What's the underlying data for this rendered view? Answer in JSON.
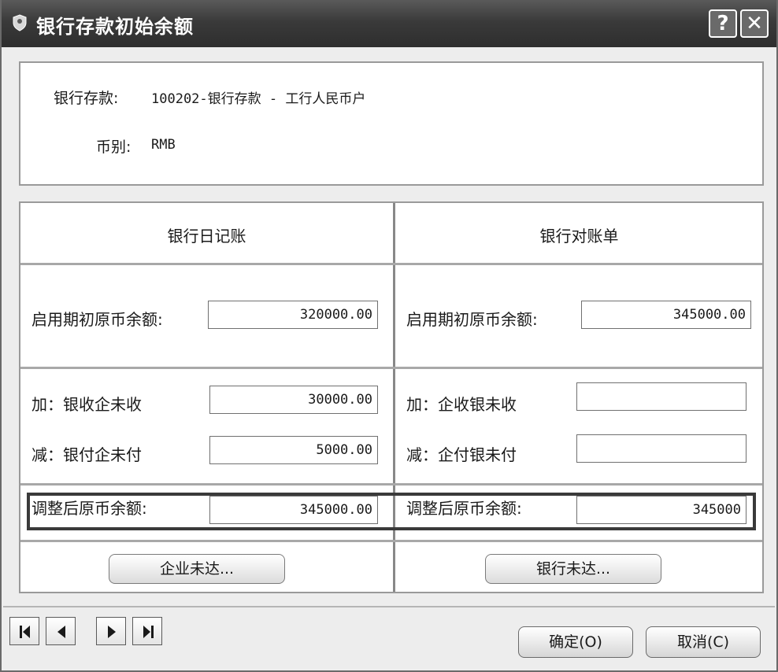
{
  "window": {
    "title": "银行存款初始余额",
    "help_label": "?",
    "close_label": "✕"
  },
  "account_info": {
    "bank_label": "银行存款:",
    "bank_value": "100202-银行存款 - 工行人民币户",
    "currency_label": "币别:",
    "currency_value": "RMB"
  },
  "left_column": {
    "header": "银行日记账",
    "opening_label": "启用期初原币余额:",
    "opening_value": "320000.00",
    "add_label": "加：银收企未收",
    "add_value": "30000.00",
    "sub_label": "减：银付企未付",
    "sub_value": "5000.00",
    "adjusted_label": "调整后原币余额:",
    "adjusted_value": "345000.00",
    "button_label": "企业未达..."
  },
  "right_column": {
    "header": "银行对账单",
    "opening_label": "启用期初原币余额:",
    "opening_value": "345000.00",
    "add_label": "加：企收银未收",
    "add_value": "",
    "sub_label": "减：企付银未付",
    "sub_value": "",
    "adjusted_label": "调整后原币余额:",
    "adjusted_value": "345000",
    "button_label": "银行未达..."
  },
  "footer": {
    "nav_icons": [
      "first-record-icon",
      "previous-record-icon",
      "next-record-icon",
      "last-record-icon"
    ],
    "ok_label": "确定(O)",
    "cancel_label": "取消(C)"
  }
}
